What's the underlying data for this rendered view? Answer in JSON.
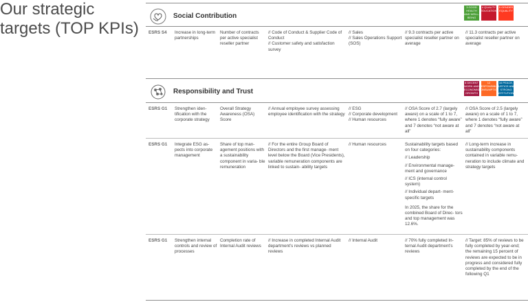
{
  "page": {
    "title": "Our strategic targets (TOP KPIs)"
  },
  "sections": [
    {
      "title": "Social Contribution",
      "icon": "heart-hands-icon",
      "sdg_badges": [
        {
          "label": "3 GOOD HEALTH AND WELL-BEING",
          "color": "#4C9F38"
        },
        {
          "label": "4 QUALITY EDUCATION",
          "color": "#C5192D"
        },
        {
          "label": "5 GENDER EQUALITY",
          "color": "#FF3A21"
        }
      ],
      "rows": [
        {
          "code": "ESRS S4",
          "objective": "Increase in long-term partnerships",
          "kpi": "Number of contracts per active specialist reseller partner",
          "measures": "// Code of Conduct & Supplier Code of Conduct\n// Customer safety and satisfaction survey",
          "responsibility": "// Sales\n// Sales Operations Support (SOS)",
          "status": "// 9.3 contracts per active specialist reseller partner on average",
          "target": "// 11.3 contracts per active specialist reseller partner on average"
        }
      ]
    },
    {
      "title": "Responsibility and Trust",
      "icon": "globe-network-icon",
      "sdg_badges": [
        {
          "label": "8 DECENT WORK AND ECONOMIC GROWTH",
          "color": "#A21942"
        },
        {
          "label": "12 RESPONSIBLE CONSUMPTION",
          "color": "#FD6925"
        },
        {
          "label": "16 PEACE, JUSTICE AND STRONG INSTITUTIONS",
          "color": "#00689D"
        }
      ],
      "rows": [
        {
          "code": "ESRS G1",
          "objective": "Strengthen iden-\ntification with the corporate strategy",
          "kpi": "Overall Strategy Awareness (OSA) Score",
          "measures": "// Annual employee survey assessing employee identification with the strategy",
          "responsibility": "// ESG\n// Corporate development\n// Human resources",
          "status": "// OSA Score of 2.7 (largely aware) on a scale of 1 to 7, where 1 denotes “fully aware” and 7 denotes “not aware at all”",
          "target": "// OSA Score of 2.5 (largely aware) on a scale of 1 to 7, where 1 denotes “fully aware” and 7 denotes “not aware at all”"
        },
        {
          "code": "ESRS G1",
          "objective": "Integrate ESG as-\npects into corporate management",
          "kpi": "Share of top man-\nagement positions with a sustainability component in varia-\nble remuneration",
          "measures": "// For the entire Group Board of Directors and the first manage-\nment level below the Board (Vice Presidents), variable remuneration components are linked to sustain-\nability targets",
          "responsibility": "// Human resources",
          "status_parts": [
            "Sustainability targets based on four categories:",
            "// Leadership",
            "// Environmental manage-\nment and governance",
            "// ICS (internal control system)",
            "// Individual depart-\nment-specific targets",
            "In 2025, the share for the combined Board of Direc-\ntors and top management was 12.6%."
          ],
          "target": "// Long-term increase in sustainability components contained in variable remu-\nneration to include climate and strategy targets"
        },
        {
          "code": "ESRS G1",
          "objective": "Strengthen internal controls and review of processes",
          "kpi": "Completion rate of Internal Audit reviews",
          "measures": "// Increase in completed Internal Audit department’s reviews vs planned reviews",
          "responsibility": "// Internal Audit",
          "status": "// 70% fully completed In-\nternal Audit department’s reviews",
          "target": "// Target: 85% of reviews to be fully completed by year-end; the remaining 15 percent of reviews are expected to be in progress and considered fully completed by the end of the following Q1"
        }
      ]
    }
  ]
}
